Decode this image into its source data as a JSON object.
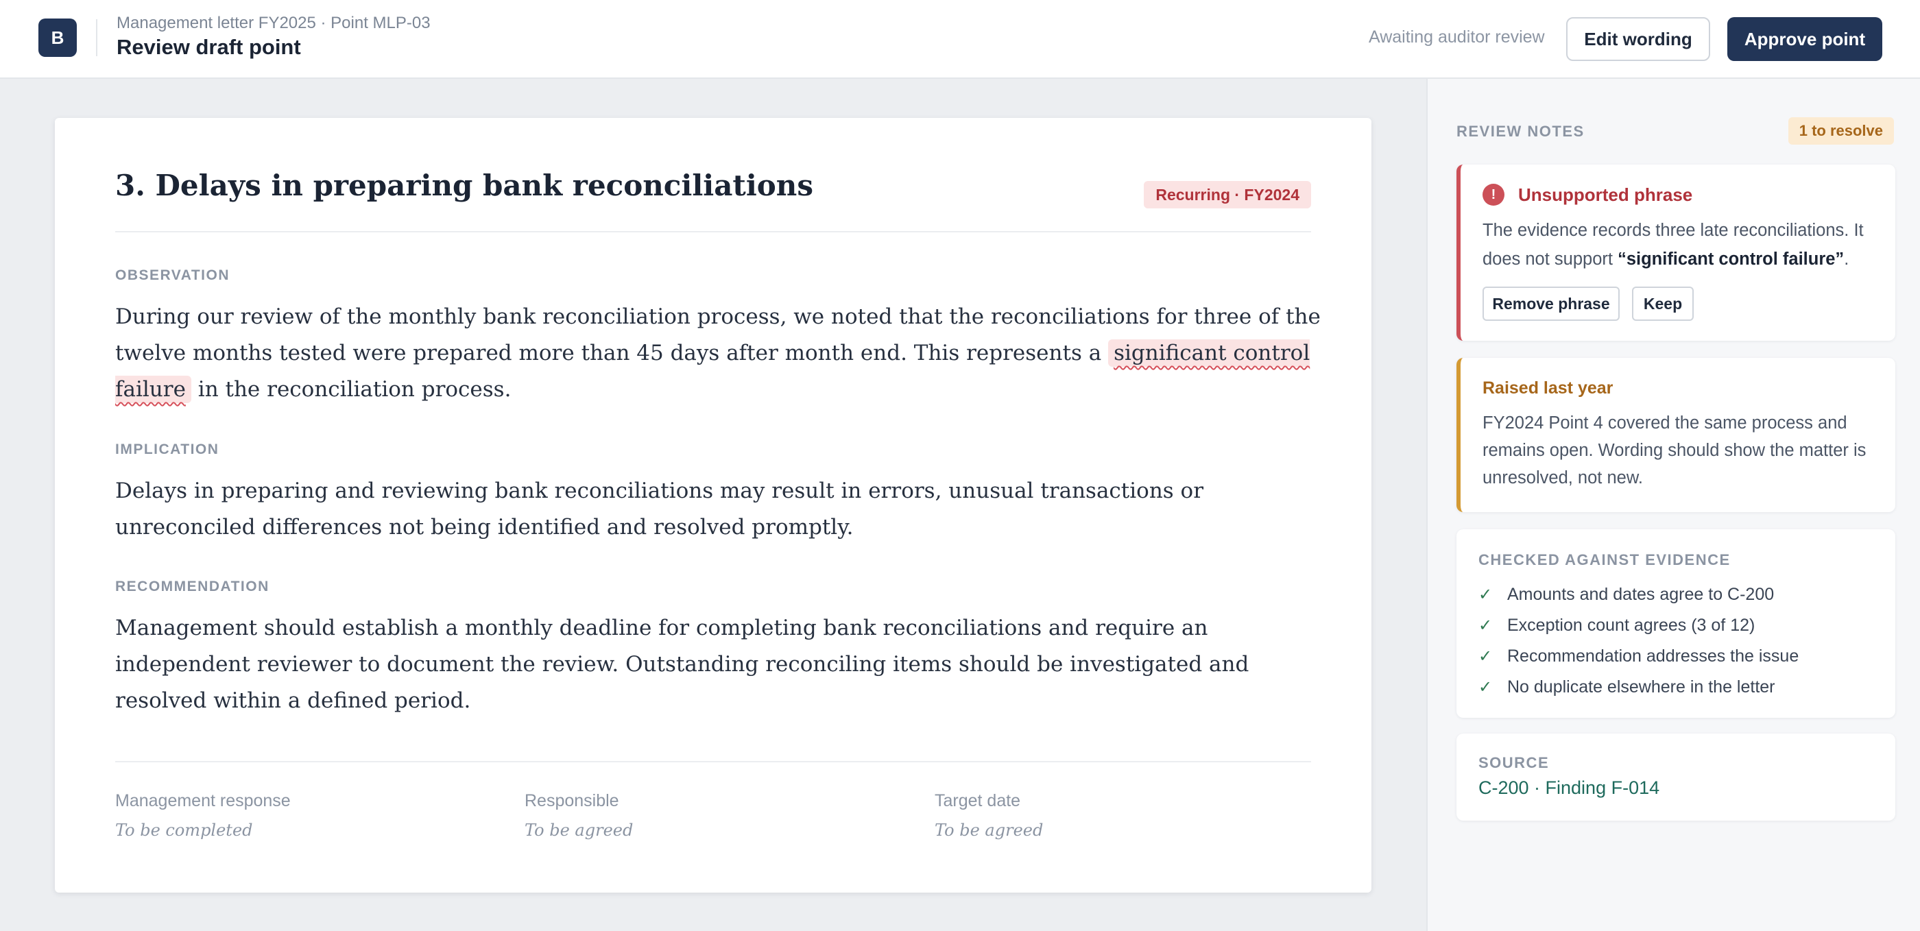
{
  "header": {
    "logo_letter": "B",
    "breadcrumb": "Management letter FY2025 · Point MLP-03",
    "title": "Review draft point",
    "status": "Awaiting auditor review",
    "edit_label": "Edit wording",
    "approve_label": "Approve point"
  },
  "document": {
    "title": "3. Delays in preparing bank reconciliations",
    "badge": "Recurring · FY2024",
    "sections": {
      "observation": {
        "label": "OBSERVATION",
        "text_before": "During our review of the monthly bank reconciliation process, we noted that the reconciliations for three of the twelve months tested were prepared more than 45 days after month end. This represents a ",
        "flagged_phrase": "significant control failure",
        "text_after": " in the reconciliation process."
      },
      "implication": {
        "label": "IMPLICATION",
        "text": "Delays in preparing and reviewing bank reconciliations may result in errors, unusual transactions or unreconciled differences not being identified and resolved promptly."
      },
      "recommendation": {
        "label": "RECOMMENDATION",
        "text": "Management should establish a monthly deadline for completing bank reconciliations and require an independent reviewer to document the review. Outstanding reconciling items should be investigated and resolved within a defined period."
      }
    },
    "footer": [
      {
        "label": "Management response",
        "value": "To be completed"
      },
      {
        "label": "Responsible",
        "value": "To be agreed"
      },
      {
        "label": "Target date",
        "value": "To be agreed"
      }
    ]
  },
  "sidebar": {
    "heading": "REVIEW NOTES",
    "resolve_badge": "1 to resolve",
    "unsupported": {
      "icon": "!",
      "title": "Unsupported phrase",
      "text_before": "The evidence records three late reconciliations. It does not support ",
      "phrase": "“significant control failure”",
      "text_after": ".",
      "remove_label": "Remove phrase",
      "keep_label": "Keep"
    },
    "prior": {
      "title": "Raised last year",
      "text": "FY2024 Point 4 covered the same process and remains open. Wording should show the matter is unresolved, not new."
    },
    "checks": {
      "heading": "CHECKED AGAINST EVIDENCE",
      "items": [
        "Amounts and dates agree to C-200",
        "Exception count agrees (3 of 12)",
        "Recommendation addresses the issue",
        "No duplicate elsewhere in the letter"
      ]
    },
    "source": {
      "heading": "SOURCE",
      "link": "C-200 · Finding F-014"
    }
  },
  "colors": {
    "primary": "#223557",
    "danger": "#cc5058",
    "warning": "#d49a33",
    "success": "#2f7a52",
    "link": "#1e6a5c"
  }
}
